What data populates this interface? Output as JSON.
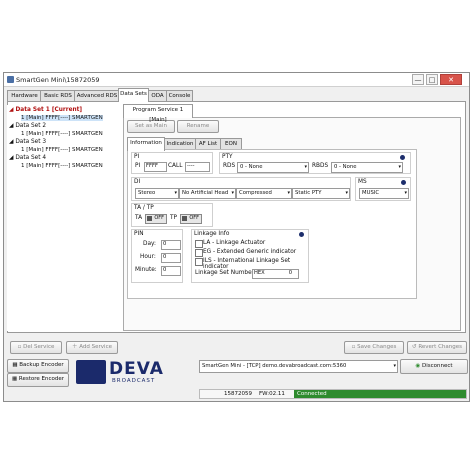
{
  "window": {
    "title": "SmartGen Mini\\15872059",
    "min_label": "—",
    "max_label": "□",
    "close_label": "✕"
  },
  "tabs": [
    "Hardware",
    "Basic RDS",
    "Advanced RDS",
    "Data Sets",
    "ODA",
    "Console"
  ],
  "tree": {
    "sets": [
      {
        "label": "Data Set 1 [Current]",
        "leaf": "1 [Main] FFFF[----] SMARTGEN"
      },
      {
        "label": "Data Set 2",
        "leaf": "1 [Main] FFFF[----] SMARTGEN"
      },
      {
        "label": "Data Set 3",
        "leaf": "1 [Main] FFFF[----] SMARTGEN"
      },
      {
        "label": "Data Set 4",
        "leaf": "1 [Main] FFFF[----] SMARTGEN"
      }
    ]
  },
  "service_tab": "Program Service 1 [Main]",
  "set_as_main": "Set as Main",
  "rename": "Rename",
  "subtabs": [
    "Information",
    "Indication",
    "AF List",
    "EON"
  ],
  "pi": {
    "label": "PI",
    "field_label": "PI",
    "value": "FFFF",
    "call_label": "CALL",
    "call_value": "----"
  },
  "pty": {
    "label": "PTY",
    "rds_label": "RDS",
    "rds_value": "0 - None",
    "rbds_label": "RBDS",
    "rbds_value": "0 - None"
  },
  "di": {
    "label": "DI",
    "v1": "Stereo",
    "v2": "No Artificial Head",
    "v3": "Compressed",
    "v4": "Static PTY"
  },
  "ms": {
    "label": "MS",
    "value": "MUSIC"
  },
  "tatp": {
    "label": "TA / TP",
    "ta_label": "TA",
    "ta_state": "OFF",
    "tp_label": "TP",
    "tp_state": "OFF"
  },
  "pin": {
    "label": "PIN",
    "day_label": "Day:",
    "day": "0",
    "hour_label": "Hour:",
    "hour": "0",
    "minute_label": "Minute:",
    "minute": "0"
  },
  "linkage": {
    "label": "Linkage Info",
    "options": [
      "LA - Linkage Actuator",
      "EG - Extended Generic indicator",
      "ILS - International Linkage Set indicator"
    ],
    "set_label": "Linkage Set Number",
    "set_value": "0",
    "set_hex": "HEX"
  },
  "actions": {
    "del_service": "Del Service",
    "add_service": "Add Service",
    "save_changes": "Save Changes",
    "revert_changes": "Revert Changes"
  },
  "bottom": {
    "backup": "Backup Encoder",
    "restore": "Restore Encoder",
    "logo_text": "DEVA",
    "logo_sub": "BROADCAST",
    "connection": "SmartGen Mini - [TCP] demo.devabroadcast.com:5360",
    "disconnect": "Disconnect",
    "serial": "15872059",
    "fw": "FW:02.11",
    "status": "Connected"
  },
  "colors": {
    "accent": "#1d2e6c",
    "connected": "#2e8b2e",
    "current_set": "#b01010"
  }
}
